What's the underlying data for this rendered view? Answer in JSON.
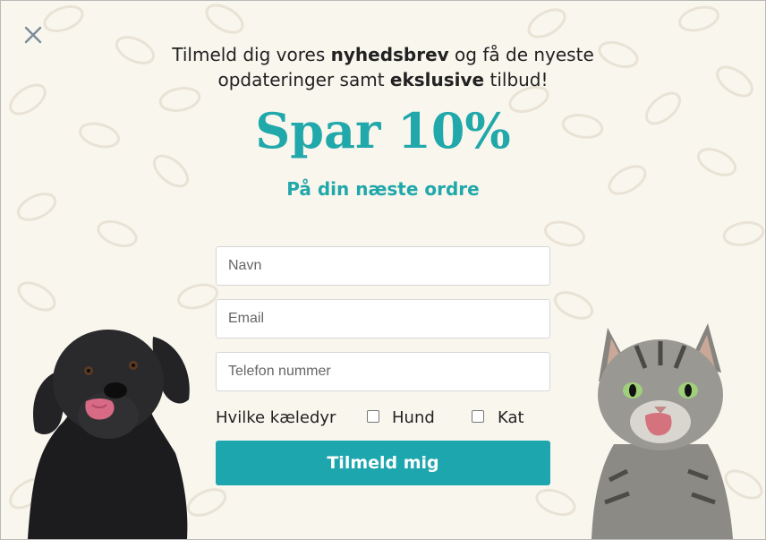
{
  "close": {
    "icon": "close-icon",
    "color": "#7a8a99"
  },
  "headline": {
    "line1_pre": "Tilmeld dig vores ",
    "line1_bold": "nyhedsbrev",
    "line1_post": " og få de nyeste",
    "line2_pre": "opdateringer samt ",
    "line2_bold": "ekslusive",
    "line2_post": " tilbud!"
  },
  "offer": {
    "title": "Spar 10%",
    "subtitle": "På din næste ordre"
  },
  "form": {
    "name_placeholder": "Navn",
    "email_placeholder": "Email",
    "phone_placeholder": "Telefon nummer",
    "pets_label": "Hvilke kæledyr",
    "pets": [
      {
        "label": "Hund",
        "checked": false
      },
      {
        "label": "Kat",
        "checked": false
      }
    ],
    "submit_label": "Tilmeld mig"
  },
  "colors": {
    "accent": "#21a8aa",
    "button": "#1ea6ae",
    "background": "#f9f6ee"
  },
  "images": {
    "left": "dog-photo",
    "right": "cat-photo"
  }
}
